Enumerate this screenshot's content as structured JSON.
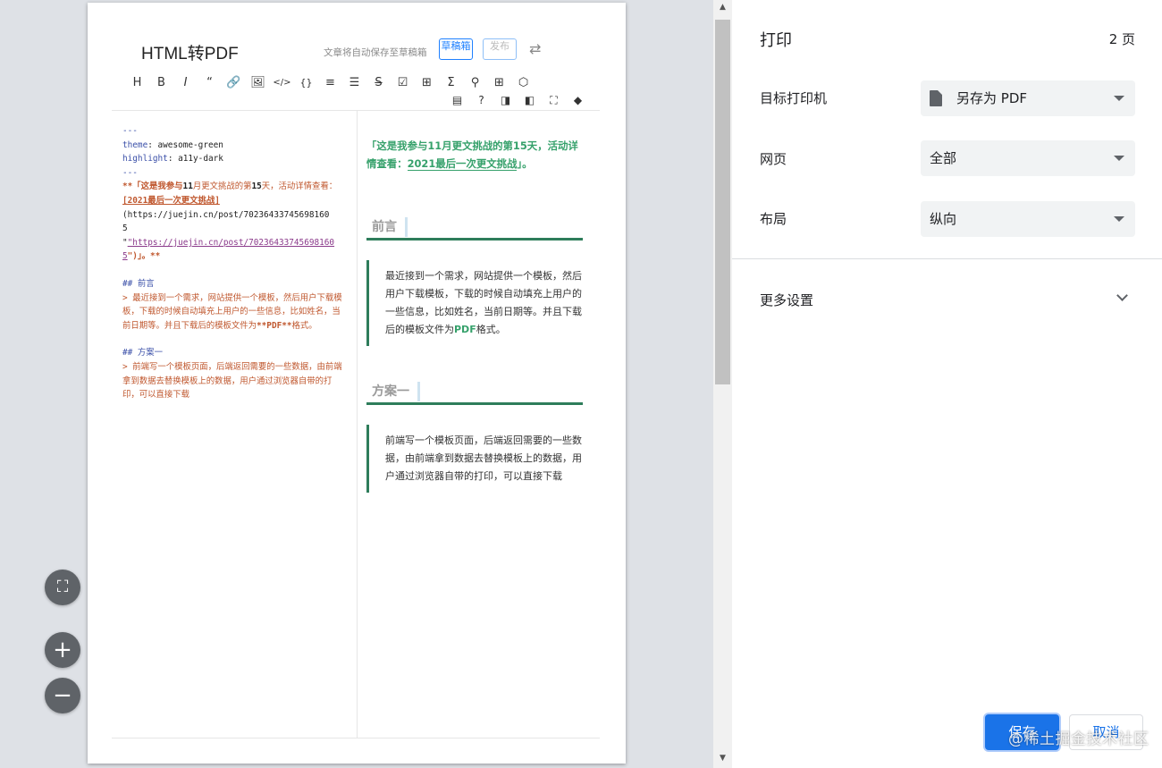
{
  "editor": {
    "title": "HTML转PDF",
    "autosave": "文章将自动保存至草稿箱",
    "draft_label": "草稿箱",
    "publish_label": "发布",
    "swap_glyph": "⇄",
    "toolbar": [
      "H",
      "B",
      "I",
      "“",
      "🔗",
      "🖼",
      "</>",
      "{}",
      "≡",
      "☰",
      "S",
      "☑",
      "⊞",
      "Σ",
      "⚲",
      "⊞",
      "⬡"
    ],
    "toolbar2": [
      "▤",
      "?",
      "◨",
      "◧",
      "⛶",
      "◆"
    ]
  },
  "markdown": {
    "line1": "---",
    "theme_key": "theme",
    "theme_val": ": awesome-green",
    "highlight_key": "highlight",
    "highlight_val": ": a11y-dark",
    "line4": "---",
    "intro1": "**「这是我参与",
    "intro1b": "11",
    "intro1c": "月更文挑战的第",
    "intro1d": "15",
    "intro1e": "天，活动详情查看：",
    "intro_link": "[2021最后一次更文挑战]",
    "intro_url": "(https://juejin.cn/post/70236433745698160",
    "intro_url2": "5",
    "intro_quote": "\"https://juejin.cn/post/70236433745698160",
    "intro_quote2": "5",
    "intro_end": "\")」。**",
    "h2_1": "## 前言",
    "p1": "> 最近接到一个需求，网站提供一个模板，然后用户下载模板，下载的时候自动填充上用户的一些信息，比如姓名，当前日期等。并且下载后的模板文件为",
    "p1_bold": "**PDF**",
    "p1_end": "格式。",
    "h2_2": "## 方案一",
    "p2": "> 前端写一个模板页面，后端返回需要的一些数据，由前端拿到数据去替换模板上的数据，用户通过浏览器自带的打印，可以直接下载"
  },
  "preview": {
    "intro_a": "「这是我参与11月更文挑战的第15天，活动详情查看：",
    "intro_link": "2021最后一次更文挑战",
    "intro_b": "」。",
    "h2_1": "前言",
    "p1_a": "最近接到一个需求，网站提供一个模板，然后用户下载模板，下载的时候自动填充上用户的一些信息，比如姓名，当前日期等。并且下载后的模板文件为",
    "p1_bold": "PDF",
    "p1_b": "格式。",
    "h2_2": "方案一",
    "p2": "前端写一个模板页面，后端返回需要的一些数据，由前端拿到数据去替换模板上的数据，用户通过浏览器自带的打印，可以直接下载"
  },
  "zoom": {
    "fit_glyph": "⛶",
    "plus_glyph": "+",
    "minus_glyph": "−"
  },
  "print": {
    "title": "打印",
    "pages": "2 页",
    "destination_label": "目标打印机",
    "destination_value": "另存为 PDF",
    "pages_label": "网页",
    "pages_value": "全部",
    "layout_label": "布局",
    "layout_value": "纵向",
    "more_label": "更多设置",
    "save_label": "保存",
    "cancel_label": "取消",
    "watermark": "@稀土掘金技术社区"
  }
}
